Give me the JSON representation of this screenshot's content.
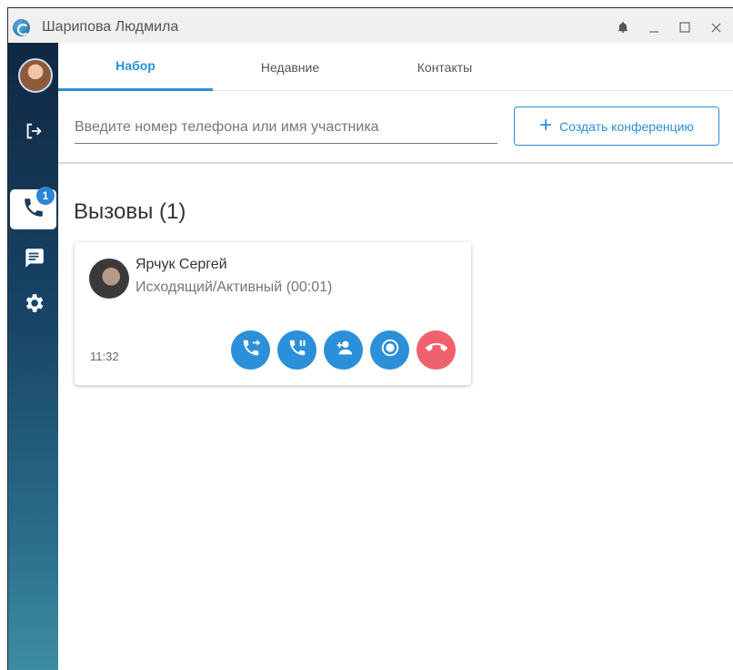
{
  "window": {
    "title": "Шарипова Людмила",
    "controls": [
      "bell-icon",
      "minimize-icon",
      "maximize-icon",
      "close-icon"
    ]
  },
  "sidebar": {
    "calls_badge": "1",
    "items": [
      "avatar",
      "logout-icon",
      "phone-icon",
      "chat-icon",
      "gear-icon"
    ]
  },
  "tabs": [
    {
      "label": "Набор",
      "active": true
    },
    {
      "label": "Недавние",
      "active": false
    },
    {
      "label": "Контакты",
      "active": false
    }
  ],
  "search": {
    "placeholder": "Введите номер телефона или имя участника"
  },
  "toolbar": {
    "create_conference_label": "Создать конференцию"
  },
  "calls": {
    "title": "Вызовы (1)",
    "items": [
      {
        "name": "Ярчук Сергей",
        "status": "Исходящий/Активный (00:01)",
        "time": "11:32",
        "actions": [
          "transfer-call-icon",
          "hold-call-icon",
          "add-participant-icon",
          "record-icon",
          "hangup-icon"
        ]
      }
    ]
  },
  "colors": {
    "accent": "#2b8fd9",
    "hangup": "#f0616e",
    "sidebar_top": "#0f2742",
    "sidebar_bottom": "#3d8da3"
  }
}
